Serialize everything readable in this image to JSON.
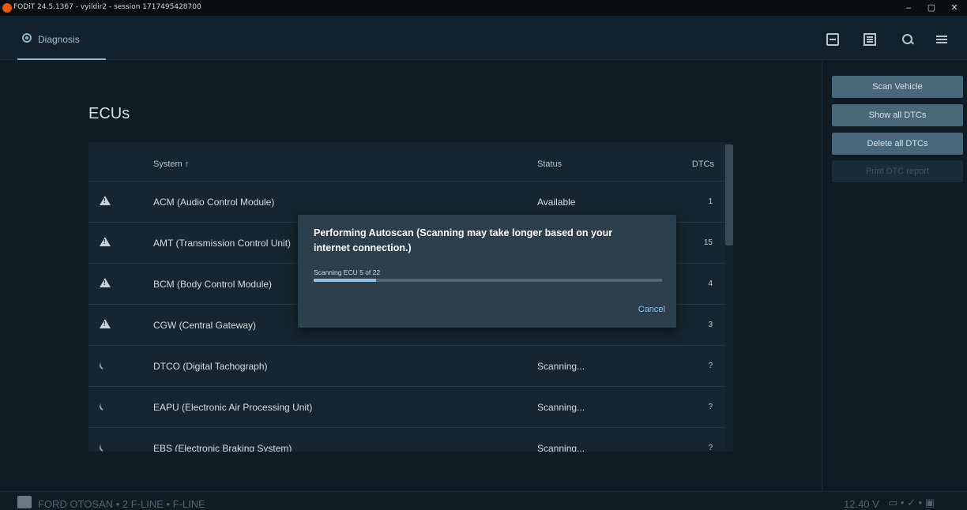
{
  "window": {
    "title": "FODiT 24.5.1367 - vyildir2 - session 1717495428700",
    "minimize": "–",
    "maximize": "▢",
    "close": "✕"
  },
  "appbar": {
    "tab_label": "Diagnosis",
    "icons": [
      "scan-icon",
      "document-icon",
      "search-icon",
      "menu-icon"
    ]
  },
  "main": {
    "title": "ECUs",
    "table": {
      "headers": {
        "system": "System ↑",
        "status": "Status",
        "dtcs": "DTCs"
      },
      "rows": [
        {
          "icon": "warning-icon",
          "system": "ACM (Audio Control Module)",
          "status": "Available",
          "dtcs": "1"
        },
        {
          "icon": "warning-icon",
          "system": "AMT (Transmission Control Unit)",
          "status": "",
          "dtcs": "15"
        },
        {
          "icon": "warning-icon",
          "system": "BCM (Body Control Module)",
          "status": "",
          "dtcs": "4"
        },
        {
          "icon": "warning-icon",
          "system": "CGW (Central Gateway)",
          "status": "",
          "dtcs": "3"
        },
        {
          "icon": "spinner-icon",
          "system": "DTCO (Digital Tachograph)",
          "status": "Scanning...",
          "dtcs": "?"
        },
        {
          "icon": "spinner-icon",
          "system": "EAPU (Electronic Air Processing Unit)",
          "status": "Scanning...",
          "dtcs": "?"
        },
        {
          "icon": "spinner-icon",
          "system": "EBS (Electronic Braking System)",
          "status": "Scanning...",
          "dtcs": "?"
        }
      ]
    }
  },
  "side": {
    "scan_vehicle": "Scan Vehicle",
    "show_all_dtcs": "Show all DTCs",
    "delete_all_dtcs": "Delete all DTCs",
    "print_dtc_report": "Print DTC report"
  },
  "dialog": {
    "title": "Performing Autoscan (Scanning may take longer based on your internet connection.)",
    "status": "Scanning ECU 5 of 22",
    "progress_percent": 18,
    "cancel": "Cancel"
  },
  "footer": {
    "vehicle": "FORD OTOSAN • 2 F-LINE • F-LINE",
    "voltage": "12.40 V",
    "icons": "▭ • ✓ • ▣"
  },
  "colors": {
    "background": "#0f1c24",
    "accent": "#8fc3e4",
    "button": "#486778"
  }
}
